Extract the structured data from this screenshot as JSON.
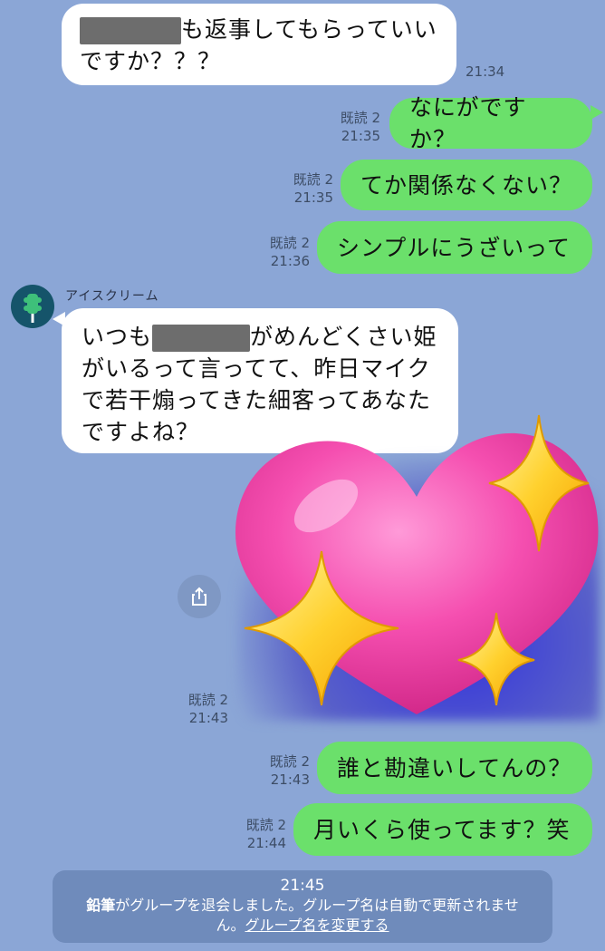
{
  "messages": {
    "m1": {
      "after_redact": "も返事してもらっていい",
      "line2": "ですか？？？",
      "time": "21:34"
    },
    "m2": {
      "text": "なにがですか？",
      "read": "既読 2",
      "time": "21:35"
    },
    "m3": {
      "text": "てか関係なくない？",
      "read": "既読 2",
      "time": "21:35"
    },
    "m4": {
      "text": "シンプルにうざいって",
      "read": "既読 2",
      "time": "21:36"
    },
    "m5": {
      "sender": "アイスクリーム",
      "line1_before": "いつも",
      "line1_after": "がめんどくさい姫",
      "line2": "がいるって言ってて、昨日マイク",
      "line3": "で若干煽ってきた細客ってあなた",
      "line4": "ですよね？"
    },
    "sticker": {
      "read": "既読 2",
      "time": "21:43",
      "icon": "sparkling-heart"
    },
    "m6": {
      "text": "誰と勘違いしてんの？",
      "read": "既読 2",
      "time": "21:43"
    },
    "m7": {
      "text": "月いくら使ってます？笑",
      "read": "既読 2",
      "time": "21:44"
    }
  },
  "notice": {
    "time": "21:45",
    "name": "鉛筆",
    "text1": "がグループを退会しました。グループ名は自動で更新されませ",
    "text2": "ん。",
    "link": "グループ名を変更する"
  },
  "colors": {
    "background": "#8ba6d6",
    "outgoing": "#6be06b",
    "incoming": "#ffffff",
    "notice": "#6f8bbb"
  }
}
